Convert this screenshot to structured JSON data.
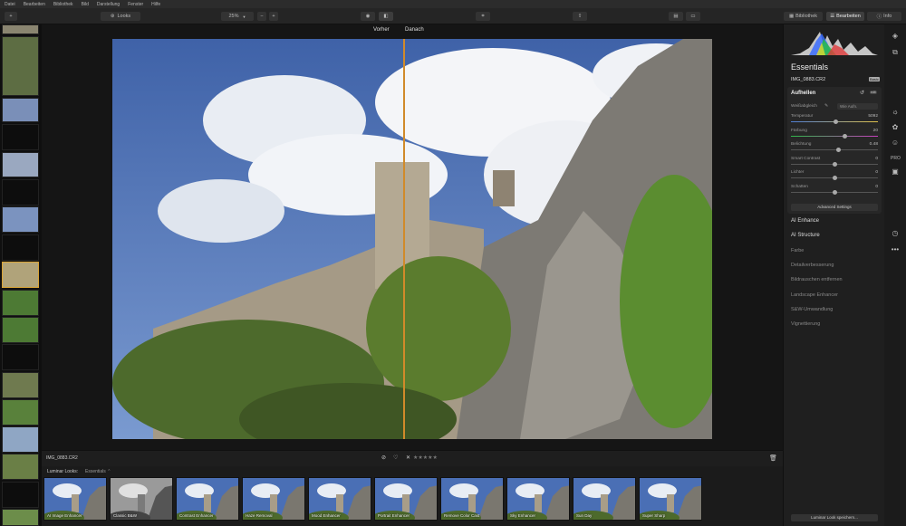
{
  "menu": [
    "Datei",
    "Bearbeiten",
    "Bibliothek",
    "Bild",
    "Darstellung",
    "Fenster",
    "Hilfe"
  ],
  "toolbar": {
    "add": "+",
    "looks": "Looks",
    "zoom": "25%",
    "zoom_minus": "−",
    "zoom_plus": "+"
  },
  "tabs": {
    "library": "Bibliothek",
    "edit": "Bearbeiten",
    "info": "Info"
  },
  "viewer": {
    "before": "Vorher",
    "after": "Danach"
  },
  "infobar": {
    "filename": "IMG_0883.CR2",
    "stars": "★★★★★"
  },
  "looks_bar": {
    "label": "Luminar Looks:",
    "category": "Essentials",
    "items": [
      "AI Image Enhancer",
      "Classic B&W",
      "Contrast Enhancer",
      "Haze Removal",
      "Mood Enhancer",
      "Portrait Enhancer",
      "Remove Color Cast",
      "Sky Enhancer",
      "Sun Day",
      "Super Sharp"
    ]
  },
  "panel": {
    "title": "Essentials",
    "file": "IMG_0883.CR2",
    "badge": "Basic",
    "section": "Aufhellen",
    "section_badge": "edit",
    "wb_label": "Weißabgleich",
    "wb_value": "Wie Aufn.",
    "sliders": [
      {
        "label": "Temperatur",
        "value": "5092",
        "level": 0.52
      },
      {
        "label": "Färbung",
        "value": "20",
        "level": 0.62
      },
      {
        "label": "Belichtung",
        "value": "0.48",
        "level": 0.55
      },
      {
        "label": "Smart Contrast",
        "value": "0",
        "level": 0.5
      },
      {
        "label": "Lichter",
        "value": "0",
        "level": 0.5
      },
      {
        "label": "Schatten",
        "value": "0",
        "level": 0.5
      }
    ],
    "advanced": "Advanced Settings",
    "tools": [
      "AI Enhance",
      "AI Structure",
      "Farbe",
      "Detailverbesserung",
      "Bildrauschen entfernen",
      "Landscape Enhancer",
      "S&W-Umwandlung",
      "Vignettierung"
    ],
    "save_look": "Luminar Look speichern..."
  },
  "colors": {
    "accent": "#d18a2a",
    "selection": "#d9a435"
  }
}
